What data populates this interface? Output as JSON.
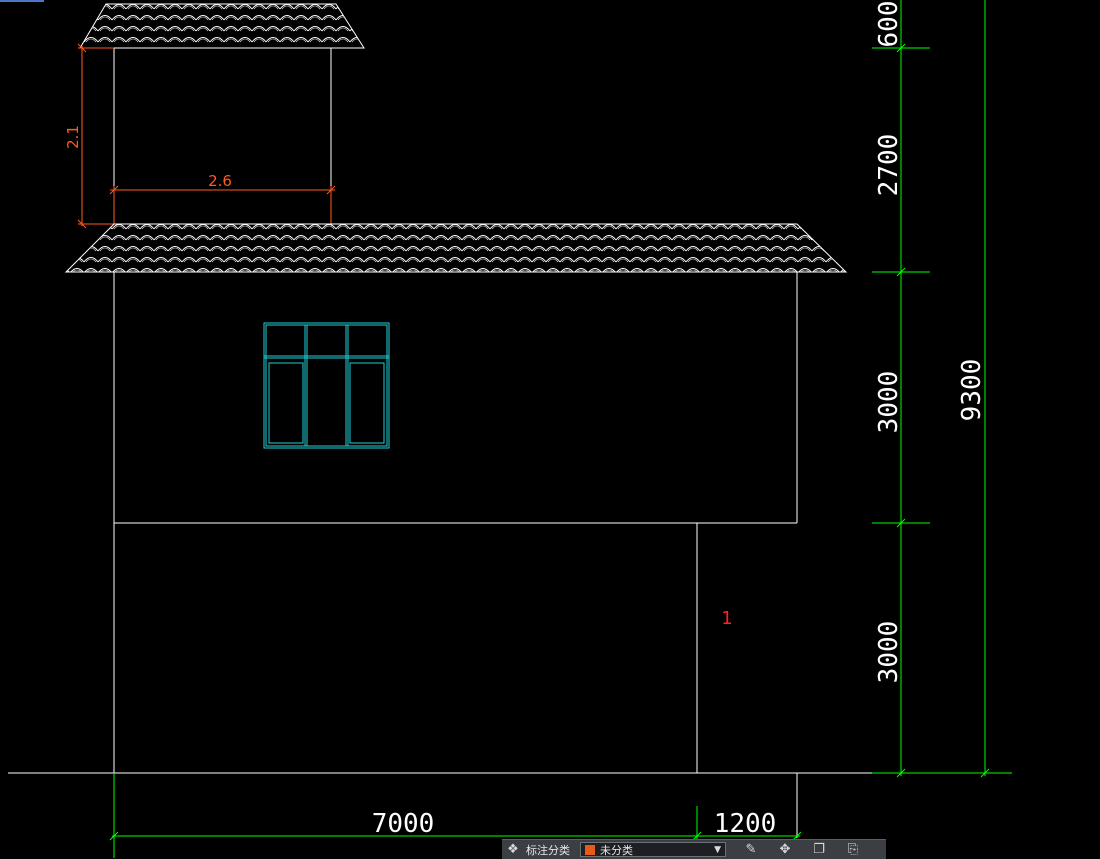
{
  "drawing": {
    "dimensions": {
      "upper_height": "2.1",
      "upper_width": "2.6",
      "v_600": "600",
      "v_2700": "2700",
      "v_3000_upper": "3000",
      "v_3000_lower": "3000",
      "v_total": "9300",
      "h_7000": "7000",
      "h_1200": "1200"
    },
    "room_label": "1",
    "colors": {
      "background": "#000000",
      "lines": "#ffffff",
      "dimension_green": "#00ff00",
      "annotation_orange": "#ff5a1f",
      "window_cyan": "#22d0d8",
      "label_red": "#ff2020"
    }
  },
  "toolbar": {
    "category_label": "标注分类",
    "category_value": "未分类",
    "category_color": "#e85a1a",
    "icons": [
      "classify-icon",
      "edit-icon",
      "move-icon",
      "copy-icon",
      "paste-icon"
    ]
  }
}
